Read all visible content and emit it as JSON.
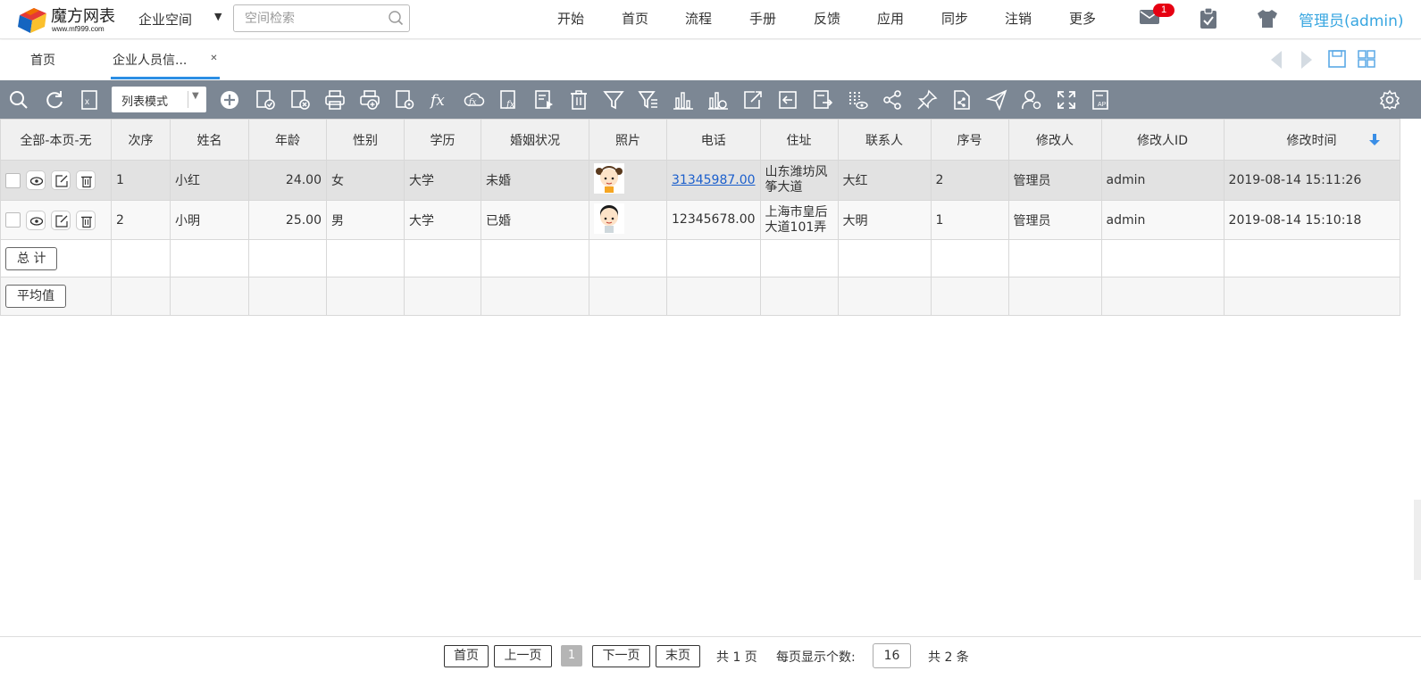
{
  "brand": {
    "title": "魔方网表",
    "subtitle": "www.mf999.com"
  },
  "header": {
    "space_label": "企业空间",
    "search_placeholder": "空间检索",
    "nav": [
      "开始",
      "首页",
      "流程",
      "手册",
      "反馈",
      "应用",
      "同步",
      "注销",
      "更多"
    ],
    "mail_count": "1",
    "user": "管理员(admin)"
  },
  "tabs": [
    {
      "label": "首页"
    },
    {
      "label": "企业人员信..."
    }
  ],
  "toolbar": {
    "mode": "列表模式"
  },
  "table": {
    "headers": [
      "全部-本页-无",
      "次序",
      "姓名",
      "年龄",
      "性别",
      "学历",
      "婚姻状况",
      "照片",
      "电话",
      "住址",
      "联系人",
      "序号",
      "修改人",
      "修改人ID",
      "修改时间"
    ],
    "rows": [
      {
        "order": "1",
        "name": "小红",
        "age": "24.00",
        "gender": "女",
        "edu": "大学",
        "marital": "未婚",
        "phone": "31345987.00",
        "address": "山东潍坊风筝大道",
        "contact": "大红",
        "seq": "2",
        "modifier": "管理员",
        "modifier_id": "admin",
        "modified": "2019-08-14 15:11:26"
      },
      {
        "order": "2",
        "name": "小明",
        "age": "25.00",
        "gender": "男",
        "edu": "大学",
        "marital": "已婚",
        "phone": "12345678.00",
        "address": "上海市皇后大道101弄",
        "contact": "大明",
        "seq": "1",
        "modifier": "管理员",
        "modifier_id": "admin",
        "modified": "2019-08-14 15:10:18"
      }
    ],
    "total_label": "总 计",
    "avg_label": "平均值"
  },
  "pager": {
    "first": "首页",
    "prev": "上一页",
    "current": "1",
    "next": "下一页",
    "last": "末页",
    "total_pages": "共 1 页",
    "per_page_label": "每页显示个数:",
    "per_page": "16",
    "total_count": "共 2 条"
  },
  "colors": {
    "toolbar": "#7c8794",
    "accent": "#2b8ee4",
    "user": "#38a6e0",
    "badge": "#e60012"
  }
}
